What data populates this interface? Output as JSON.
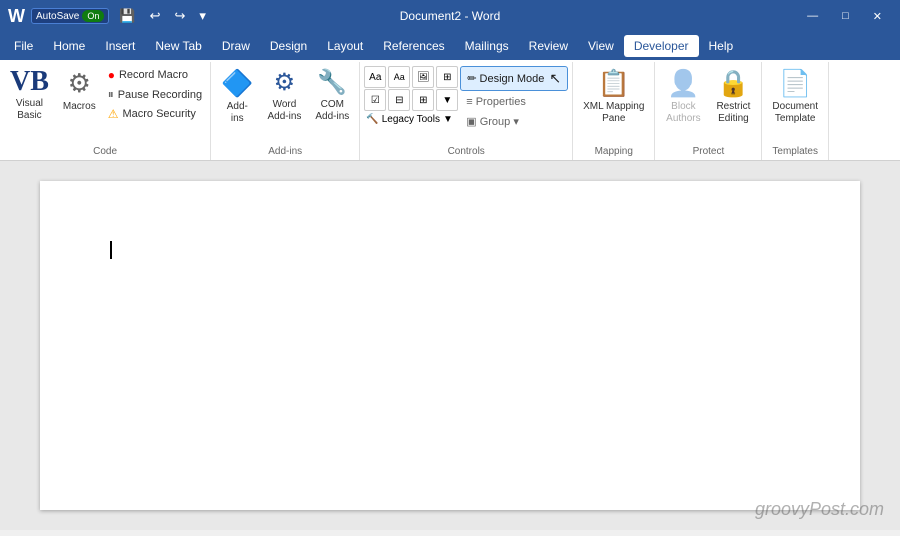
{
  "titlebar": {
    "autosave": "AutoSave",
    "toggle": "On",
    "title": "Document2 - Word",
    "undo_icon": "↩",
    "redo_icon": "↪",
    "minimize": "—",
    "maximize": "□",
    "close": "✕"
  },
  "menubar": {
    "items": [
      {
        "id": "file",
        "label": "File"
      },
      {
        "id": "home",
        "label": "Home"
      },
      {
        "id": "insert",
        "label": "Insert"
      },
      {
        "id": "new-tab",
        "label": "New Tab"
      },
      {
        "id": "draw",
        "label": "Draw"
      },
      {
        "id": "design",
        "label": "Design"
      },
      {
        "id": "layout",
        "label": "Layout"
      },
      {
        "id": "references",
        "label": "References"
      },
      {
        "id": "mailings",
        "label": "Mailings"
      },
      {
        "id": "review",
        "label": "Review"
      },
      {
        "id": "view",
        "label": "View"
      },
      {
        "id": "developer",
        "label": "Developer",
        "active": true
      },
      {
        "id": "help",
        "label": "Help"
      }
    ]
  },
  "ribbon": {
    "groups": {
      "code": {
        "label": "Code",
        "visual_basic": "Visual\nBasic",
        "macros": "Macros",
        "record_macro": "Record Macro",
        "pause_recording": "Pause Recording",
        "macro_security": "Macro Security"
      },
      "addins": {
        "label": "Add-ins",
        "add_ins": "Add-\nins",
        "word_add_ins": "Word\nAdd-ins",
        "com_add_ins": "COM\nAdd-ins"
      },
      "controls": {
        "label": "Controls",
        "design_mode": "Design Mode",
        "properties": "Properties",
        "group": "Group"
      },
      "mapping": {
        "label": "Mapping",
        "xml_mapping_pane": "XML Mapping\nPane"
      },
      "protect": {
        "label": "Protect",
        "block_authors": "Block\nAuthors",
        "restrict_editing": "Restrict\nEditing"
      },
      "templates": {
        "label": "Templates",
        "document_template": "Document\nTemplate"
      }
    }
  },
  "document": {
    "watermark": "groovyPost.com"
  }
}
